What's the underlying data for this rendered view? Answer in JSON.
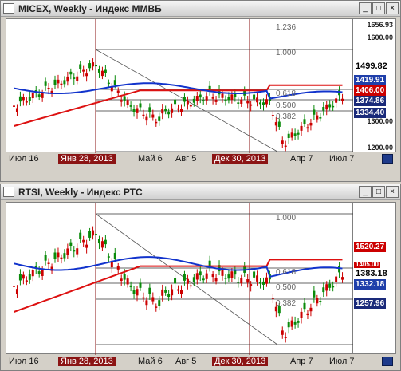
{
  "windows": [
    {
      "title": "MICEX, Weekly - Индекс ММВБ",
      "buttons": [
        "_",
        "□",
        "×"
      ],
      "y_labels": [
        "1656.93",
        "1600.00",
        "1499.82",
        "1419.91",
        "1406.00",
        "1374.86",
        "1334.40",
        "1300.00",
        "1200.00"
      ],
      "x_labels": [
        "Июл 16",
        "Янв 28, 2013",
        "Май 6",
        "Авг 5",
        "Дек 30, 2013",
        "Апр 7",
        "Июл 7"
      ],
      "fib_labels": [
        "1.236",
        "1.000",
        "0.618",
        "0.500",
        "0.382"
      ],
      "colors": {
        "up": "#0a8a0a",
        "down": "#cc0000",
        "ma_red": "#dd1111",
        "ma_blue": "#1133cc",
        "tag_red": "#cc0000",
        "tag_navy": "#1a2a7a",
        "tag_blue": "#1f3faa",
        "highlight": "#8b1414"
      }
    },
    {
      "title": "RTSI, Weekly - Индекс РТС",
      "buttons": [
        "_",
        "□",
        "×"
      ],
      "y_labels": [
        "1520.27",
        "1405.00",
        "1383.18",
        "1332.18",
        "1257.96"
      ],
      "x_labels": [
        "Июл 16",
        "Янв 28, 2013",
        "Май 6",
        "Авг 5",
        "Дек 30, 2013",
        "Апр 7",
        "Июл 7"
      ],
      "fib_labels": [
        "1.000",
        "0.618",
        "0.500",
        "0.382"
      ],
      "colors": {
        "up": "#0a8a0a",
        "down": "#cc0000",
        "ma_red": "#dd1111",
        "ma_blue": "#1133cc",
        "tag_red": "#cc0000",
        "tag_navy": "#1a2a7a",
        "tag_blue": "#1f3faa",
        "highlight": "#8b1414"
      }
    }
  ]
}
